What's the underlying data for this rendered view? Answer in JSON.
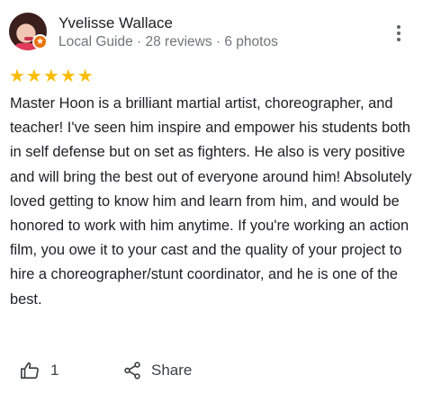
{
  "reviewer": {
    "name": "Yvelisse Wallace",
    "meta": "Local Guide · 28 reviews · 6 photos"
  },
  "rating": {
    "stars": 5,
    "max": 5
  },
  "review": {
    "text": "Master Hoon is a brilliant martial artist, choreographer, and teacher! I've seen him inspire and empower his students both in self defense but on set as fighters. He also is very positive and will bring the best out of everyone around him! Absolutely loved getting to know him and learn from him, and would be honored to work with him anytime. If you're working an action film, you owe it to your cast and the quality of your project to hire a choreographer/stunt coordinator, and he is one of the best."
  },
  "actions": {
    "like_count": "1",
    "share_label": "Share"
  },
  "colors": {
    "star": "#fbbc04",
    "local_guide_badge": "#e8710a",
    "secondary_text": "#70757a"
  }
}
